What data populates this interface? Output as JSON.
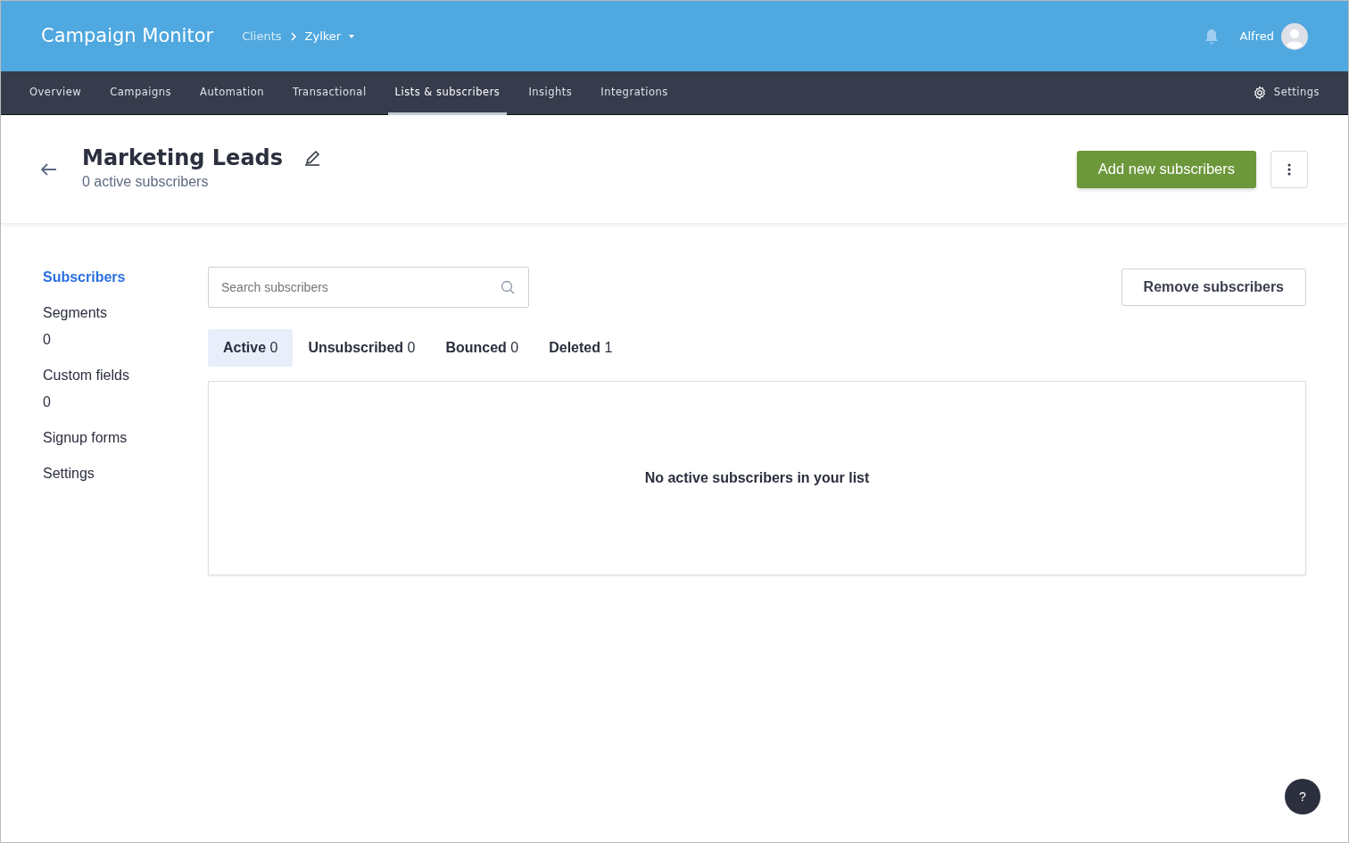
{
  "header": {
    "app_title": "Campaign Monitor",
    "breadcrumb": [
      "Clients",
      "Zylker"
    ],
    "user": "Alfred"
  },
  "nav": {
    "items": [
      {
        "label": "Overview",
        "selected": false
      },
      {
        "label": "Campaigns",
        "selected": false
      },
      {
        "label": "Automation",
        "selected": false
      },
      {
        "label": "Transactional",
        "selected": false
      },
      {
        "label": "Lists & subscribers",
        "selected": true
      },
      {
        "label": "Insights",
        "selected": false
      },
      {
        "label": "Integrations",
        "selected": false
      }
    ],
    "settings": "Settings"
  },
  "list": {
    "title": "Marketing Leads",
    "subtitle": "0 active subscribers",
    "primary_button": "Add new subscribers"
  },
  "sidebar": {
    "items": [
      {
        "label": "Subscribers",
        "selected": true
      },
      {
        "label": "Segments",
        "count": "0",
        "selected": false
      },
      {
        "label": "Custom fields",
        "count": "0",
        "selected": false
      },
      {
        "label": "Signup forms",
        "selected": false
      },
      {
        "label": "Settings",
        "selected": false
      }
    ]
  },
  "search": {
    "placeholder": "Search subscribers"
  },
  "remove_button": "Remove subscribers",
  "tabs": [
    {
      "label": "Active",
      "count": "0",
      "selected": true
    },
    {
      "label": "Unsubscribed",
      "count": "0",
      "selected": false
    },
    {
      "label": "Bounced",
      "count": "0",
      "selected": false
    },
    {
      "label": "Deleted",
      "count": "1",
      "selected": false
    }
  ],
  "empty_message": "No active subscribers in your list",
  "help_button": "?"
}
